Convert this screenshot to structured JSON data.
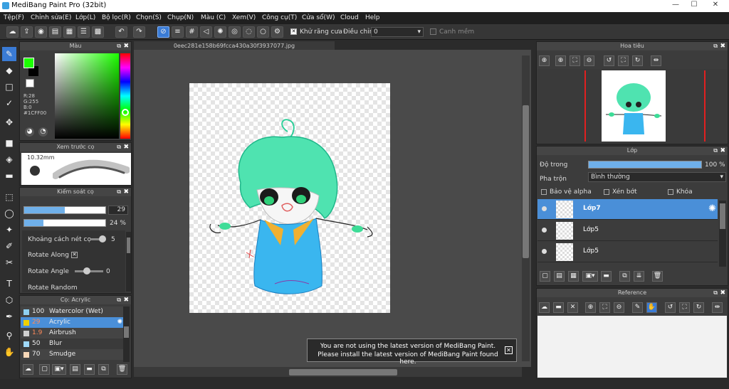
{
  "app": {
    "title": "MediBang Paint Pro (32bit)"
  },
  "menu": [
    "Tệp(F)",
    "Chỉnh sửa(E)",
    "Lớp(L)",
    "Bộ lọc(R)",
    "Chọn(S)",
    "Chụp(N)",
    "Màu (C)",
    "Xem(V)",
    "Công cụ(T)",
    "Cửa sổ(W)",
    "Cloud",
    "Help"
  ],
  "toolbar": {
    "antialias_label": "Khử răng cưa",
    "correction_label": "Điều chỉnh",
    "correction_value": "0",
    "snap_label": "Canh mềm"
  },
  "color_panel": {
    "title": "Màu",
    "r": "R:28",
    "g": "G:255",
    "b": "B:0",
    "hex": "#1CFF00",
    "fg": "#1cff00",
    "bg": "#000000"
  },
  "brush_preview": {
    "title": "Xem trước cọ",
    "size": "10.32mm"
  },
  "brush_control": {
    "title": "Kiểm soát cọ",
    "size_value": "29",
    "opacity_value": "24 %",
    "spacing_label": "Khoảng cách nét cọ",
    "spacing_value": "5",
    "rotate_along_label": "Rotate Along",
    "rotate_angle_label": "Rotate Angle",
    "rotate_angle_value": "0",
    "rotate_random_label": "Rotate Random",
    "size_fraction": 0.5,
    "opacity_fraction": 0.24
  },
  "brush_list": {
    "title": "Cọ: Acrylic",
    "items": [
      {
        "size": "100",
        "name": "Watercolor (Wet)",
        "color": "#8fd0f0",
        "selected": false
      },
      {
        "size": "29",
        "name": "Acrylic",
        "color": "#f0d000",
        "selected": true
      },
      {
        "size": "1.9",
        "name": "Airbrush",
        "color": "#d0d0d0",
        "selected": false
      },
      {
        "size": "50",
        "name": "Blur",
        "color": "#9fd8f8",
        "selected": false
      },
      {
        "size": "70",
        "name": "Smudge",
        "color": "#f8d8b8",
        "selected": false
      }
    ]
  },
  "document": {
    "tab": "0eec281e158b69fcca430a30f3937077.jpg"
  },
  "navigator": {
    "title": "Hoa tiêu"
  },
  "layers": {
    "title": "Lớp",
    "opacity_label": "Độ trong",
    "opacity_value": "100 %",
    "opacity_fraction": 1.0,
    "blend_label": "Pha trộn",
    "blend_value": "Bình thường",
    "protect_alpha": "Bảo vệ alpha",
    "clipping": "Xén bớt",
    "lock": "Khóa",
    "items": [
      {
        "name": "Lớp7",
        "selected": true
      },
      {
        "name": "Lớp5",
        "selected": false
      },
      {
        "name": "Lớp5",
        "selected": false
      }
    ]
  },
  "reference": {
    "title": "Reference"
  },
  "notice": {
    "line1": "You are not using the latest version of MediBang Paint.",
    "line2": "Please install the latest version of MediBang Paint found here."
  }
}
